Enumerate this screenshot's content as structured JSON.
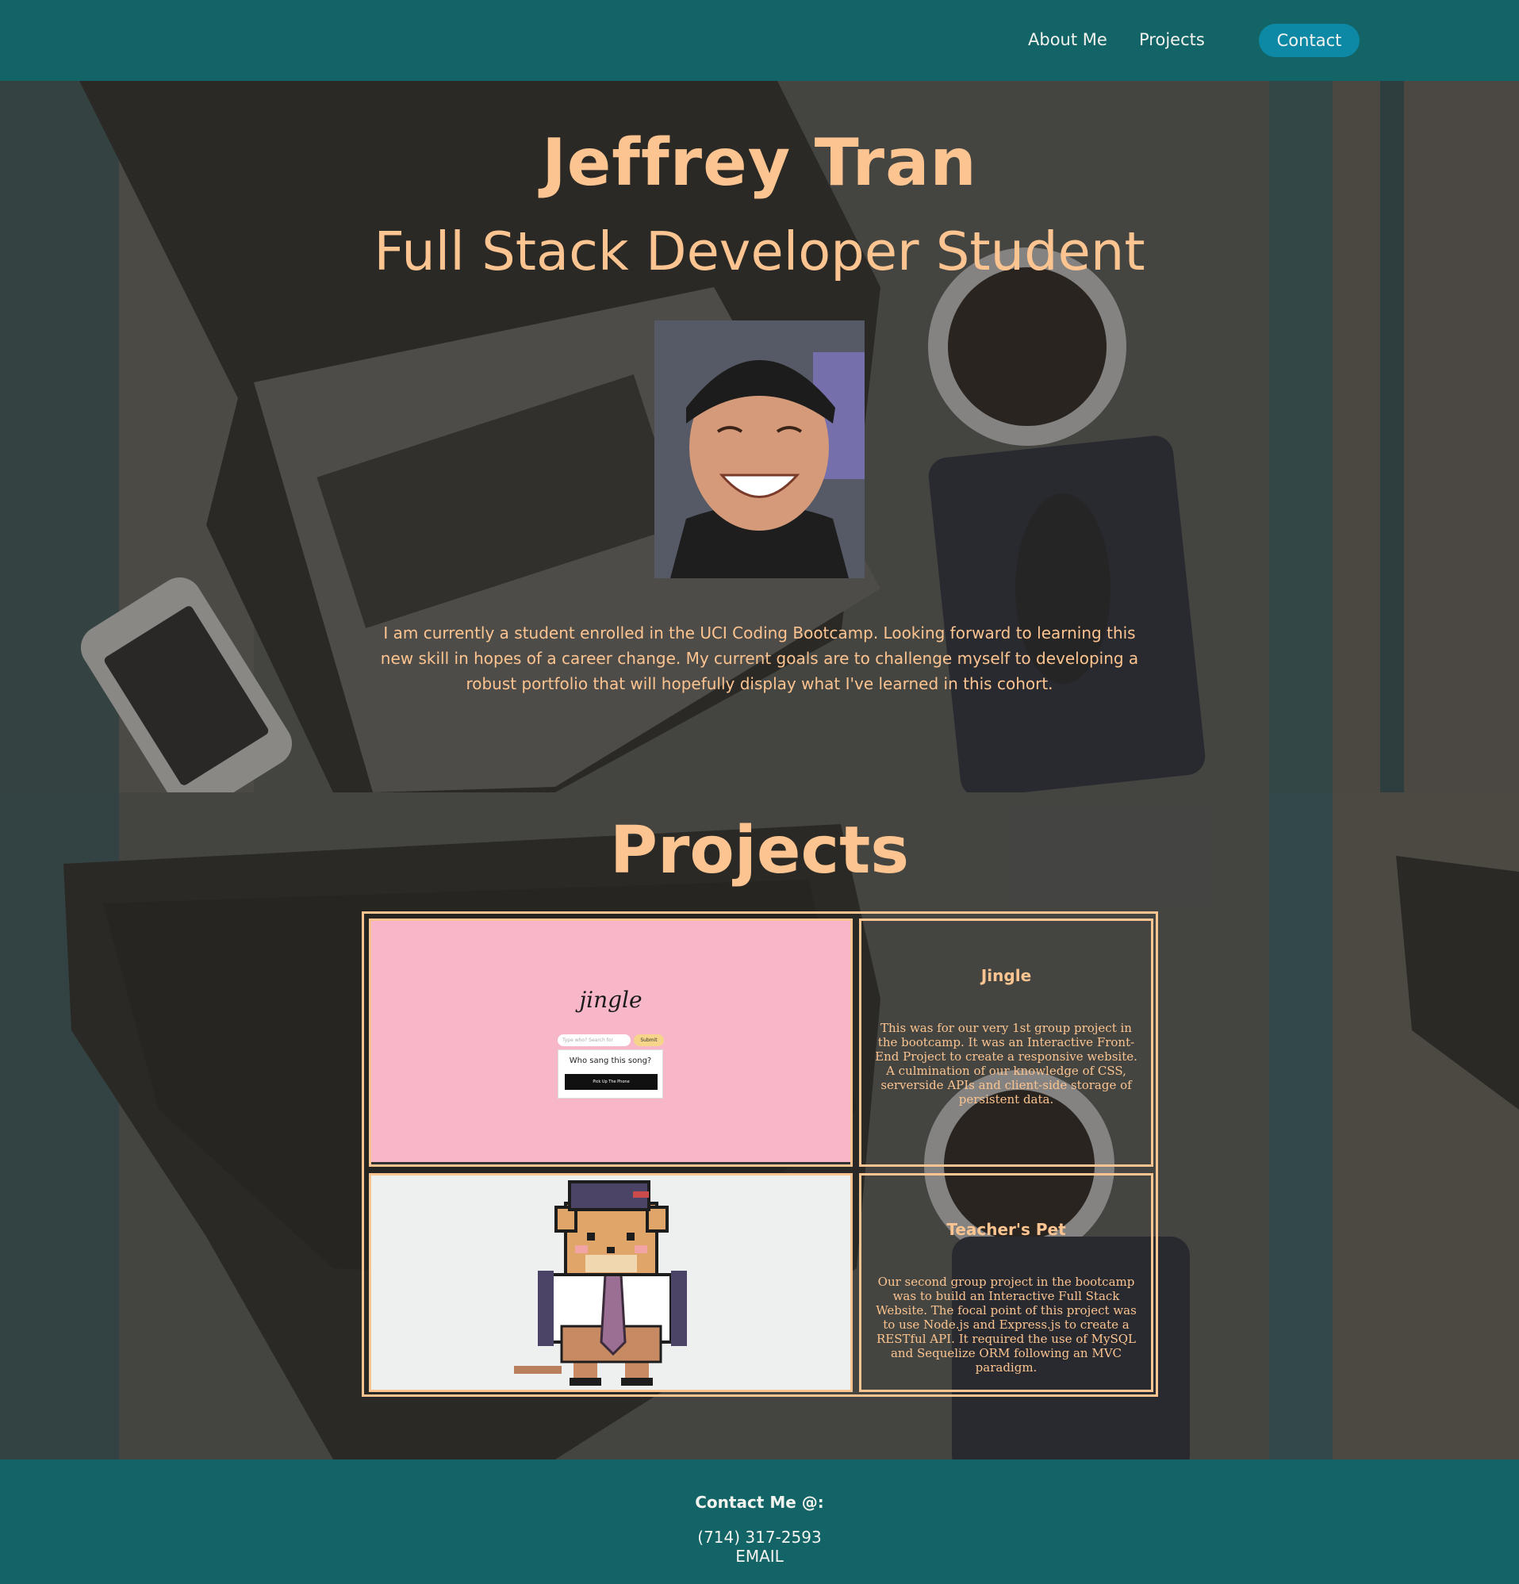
{
  "nav": {
    "about": "About Me",
    "projects": "Projects",
    "contact": "Contact"
  },
  "hero": {
    "name": "Jeffrey Tran",
    "subtitle": "Full Stack Developer Student",
    "bio": "I am currently a student enrolled in the UCI Coding Bootcamp. Looking forward to learning this new skill in hopes of a career change. My current goals are to challenge myself to developing a robust portfolio that will hopefully display what I've learned in this cohort."
  },
  "projects": {
    "title": "Projects",
    "items": [
      {
        "name": "Jingle",
        "description": "This was for our very 1st group project in the bootcamp. It was an Interactive Front-End Project to create a responsive website. A culmination of our knowledge of CSS, serverside APIs and client-side storage of persistent data.",
        "preview": {
          "logo": "jingle",
          "input_placeholder": "Type who? Search for artist...",
          "submit": "Submit",
          "question": "Who sang this song?",
          "button": "Pick Up The Phone"
        }
      },
      {
        "name": "Teacher's Pet",
        "description": "Our second group project in the bootcamp was to build an Interactive Full Stack Website. The focal point of this project was to use Node.js and Express.js to create a RESTful API. It required the use of MySQL and Sequelize ORM following an MVC paradigm."
      }
    ]
  },
  "footer": {
    "heading": "Contact Me @:",
    "phone": "(714) 317-2593",
    "email": "EMAIL"
  },
  "colors": {
    "nav": "#126466",
    "accent": "#fcc490",
    "contact_button": "#0d89a6",
    "jingle_bg": "#f8b6c9"
  }
}
